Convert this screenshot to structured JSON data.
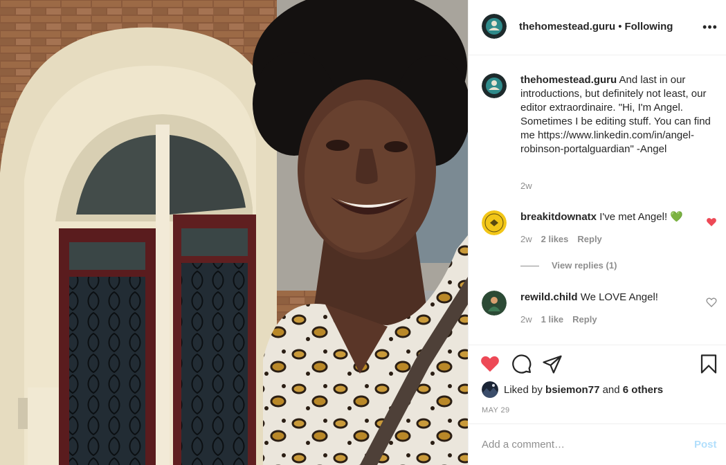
{
  "header": {
    "username": "thehomestead.guru",
    "separator": "•",
    "follow_status": "Following",
    "more_icon": "more-horizontal-icon"
  },
  "caption": {
    "username": "thehomestead.guru",
    "text": "And last in our introductions, but definitely not least, our editor extraordinaire. \"Hi, I'm Angel. Sometimes I be editing stuff. You can find me https://www.linkedin.com/in/angel-robinson-portalguardian\" -Angel",
    "time": "2w"
  },
  "comments": [
    {
      "username": "breakitdownatx",
      "text": "I've met Angel! 💚",
      "time": "2w",
      "likes": "2 likes",
      "reply_label": "Reply",
      "liked": true
    },
    {
      "username": "rewild.child",
      "text": "We LOVE Angel!",
      "time": "2w",
      "likes": "1 like",
      "reply_label": "Reply",
      "liked": false
    }
  ],
  "view_replies": "View replies (1)",
  "actions": {
    "like_icon": "heart-filled-icon",
    "comment_icon": "comment-icon",
    "share_icon": "share-icon",
    "save_icon": "bookmark-icon"
  },
  "likes": {
    "prefix": "Liked by",
    "user": "bsiemon77",
    "connector": "and",
    "others": "6 others"
  },
  "date": "MAY 29",
  "add_comment": {
    "placeholder": "Add a comment…",
    "post_label": "Post"
  },
  "colors": {
    "like_red": "#ed4956",
    "text": "#262626",
    "secondary": "#8e8e8e",
    "post_disabled": "#b2dffc",
    "border": "#efefef"
  }
}
